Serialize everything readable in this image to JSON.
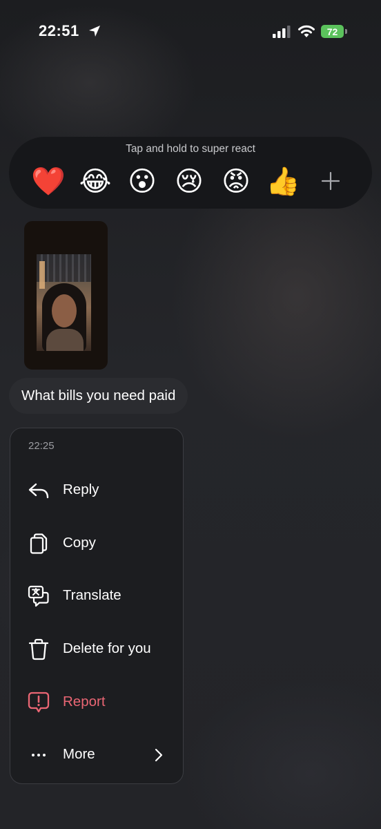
{
  "status_bar": {
    "time": "22:51",
    "battery": "72",
    "battery_color": "#5bc25c",
    "icons": [
      "location-icon",
      "signal-icon",
      "wifi-icon",
      "battery-icon"
    ]
  },
  "reactions": {
    "hint": "Tap and hold to super react",
    "emojis": [
      "❤️",
      "😂",
      "😮",
      "😢",
      "😡",
      "👍"
    ],
    "more_icon": "plus-icon"
  },
  "message": {
    "image_alt": "photo",
    "text": "What bills you need paid"
  },
  "menu": {
    "timestamp": "22:25",
    "items": [
      {
        "label": "Reply",
        "icon": "reply-icon"
      },
      {
        "label": "Copy",
        "icon": "copy-icon"
      },
      {
        "label": "Translate",
        "icon": "translate-icon"
      },
      {
        "label": "Delete for you",
        "icon": "trash-icon"
      },
      {
        "label": "Report",
        "icon": "report-icon",
        "color": "#ea6674"
      },
      {
        "label": "More",
        "icon": "more-dots-icon"
      }
    ]
  }
}
